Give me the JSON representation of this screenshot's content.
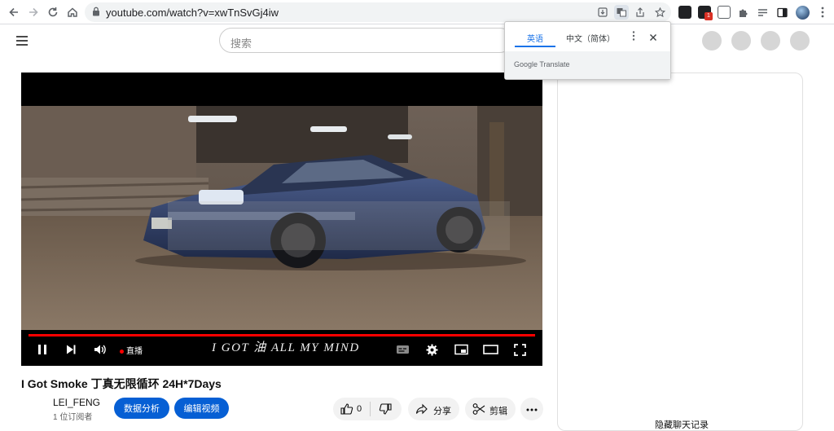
{
  "browser": {
    "url": "youtube.com/watch?v=xwTnSvGj4iw",
    "extension_badge": "1"
  },
  "header": {
    "search_placeholder": "搜索"
  },
  "translate_popup": {
    "tab_source": "英语",
    "tab_target": "中文（简体）",
    "footer": "Google Translate"
  },
  "player": {
    "live_label": "直播",
    "caption": "I GOT 油 ALL MY MIND",
    "progress": 1.0,
    "accent_color": "#ff0000"
  },
  "video": {
    "title": "I Got Smoke 丁真无限循环 24H*7Days",
    "channel": "LEI_FENG",
    "subscribers": "1 位订阅者",
    "analytics_button": "数据分析",
    "edit_button": "编辑视频",
    "likes": "0",
    "share_label": "分享",
    "clip_label": "剪辑"
  },
  "sidebar": {
    "history_off_text": "隐藏聊天记录"
  },
  "icons": [
    "back-icon",
    "forward-icon",
    "reload-icon",
    "home-icon",
    "lock-icon",
    "install-icon",
    "translate-icon",
    "share-icon",
    "star-icon",
    "puzzle-icon",
    "reading-list-icon",
    "sidebar-icon",
    "profile-icon",
    "menu-icon",
    "hamburger-icon",
    "pause-icon",
    "next-icon",
    "volume-icon",
    "subtitles-icon",
    "settings-icon",
    "miniplayer-icon",
    "theater-icon",
    "fullscreen-icon",
    "thumb-up-icon",
    "thumb-down-icon",
    "share-arrow-icon",
    "scissors-icon",
    "more-icon"
  ],
  "colors": {
    "youtube_blue": "#065fd4",
    "progress_red": "#ff0000",
    "chrome_grey": "#f1f3f4"
  }
}
